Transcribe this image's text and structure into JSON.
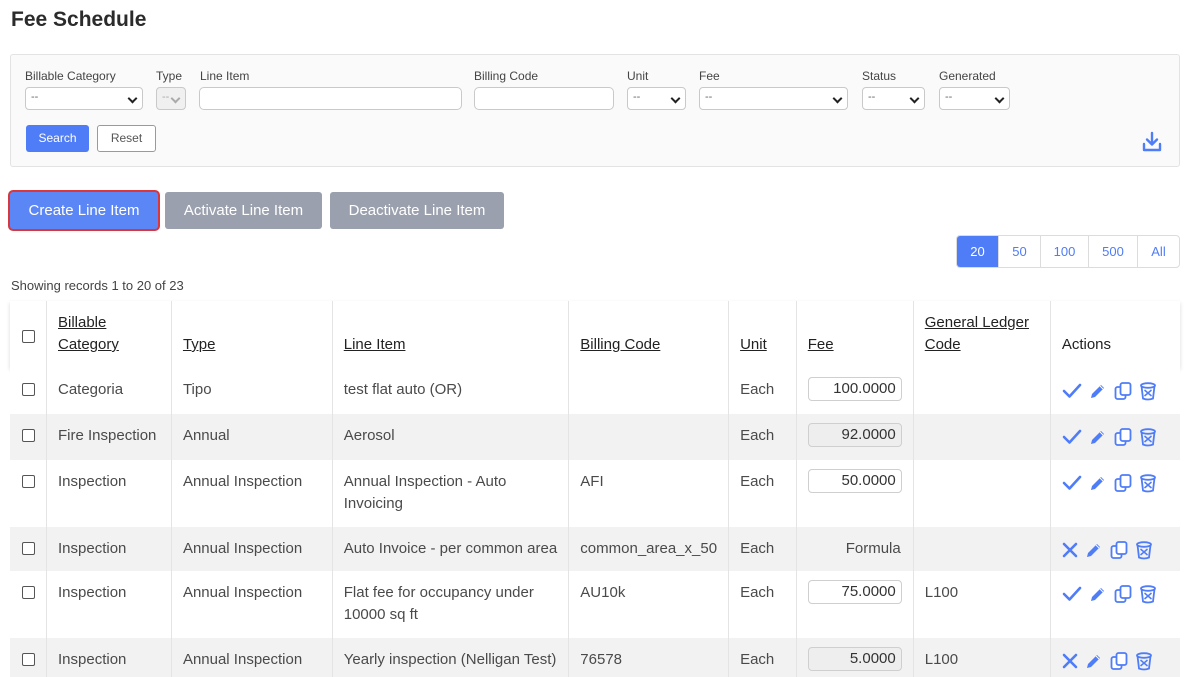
{
  "page": {
    "title": "Fee Schedule"
  },
  "filters": {
    "billable_category": {
      "label": "Billable Category",
      "value": "--"
    },
    "type": {
      "label": "Type",
      "value": "--"
    },
    "line_item": {
      "label": "Line Item",
      "value": ""
    },
    "billing_code": {
      "label": "Billing Code",
      "value": ""
    },
    "unit": {
      "label": "Unit",
      "value": "--"
    },
    "fee": {
      "label": "Fee",
      "value": "--"
    },
    "status": {
      "label": "Status",
      "value": "--"
    },
    "generated": {
      "label": "Generated",
      "value": "--"
    },
    "search_label": "Search",
    "reset_label": "Reset"
  },
  "toolbar": {
    "create_label": "Create Line Item",
    "activate_label": "Activate Line Item",
    "deactivate_label": "Deactivate Line Item"
  },
  "pager": {
    "sizes": [
      "20",
      "50",
      "100",
      "500",
      "All"
    ],
    "selected": "20"
  },
  "records_text": "Showing records 1 to 20 of 23",
  "table": {
    "headers": {
      "billable_category": "Billable Category",
      "type": "Type",
      "line_item": "Line Item",
      "billing_code": "Billing Code",
      "unit": "Unit",
      "fee": "Fee",
      "gl_code": "General Ledger Code",
      "actions": "Actions"
    },
    "rows": [
      {
        "category": "Categoria",
        "type": "Tipo",
        "line_item": "test flat auto (OR)",
        "billing_code": "",
        "unit": "Each",
        "fee": "100.0000",
        "fee_kind": "editable",
        "gl_code": "",
        "status_icon": "check-icon"
      },
      {
        "category": "Fire Inspection",
        "type": "Annual",
        "line_item": "Aerosol",
        "billing_code": "",
        "unit": "Each",
        "fee": "92.0000",
        "fee_kind": "readonly",
        "gl_code": "",
        "status_icon": "check-icon"
      },
      {
        "category": "Inspection",
        "type": "Annual Inspection",
        "line_item": "Annual Inspection - Auto Invoicing",
        "billing_code": "AFI",
        "unit": "Each",
        "fee": "50.0000",
        "fee_kind": "editable",
        "gl_code": "",
        "status_icon": "check-icon"
      },
      {
        "category": "Inspection",
        "type": "Annual Inspection",
        "line_item": "Auto Invoice - per common area",
        "billing_code": "common_area_x_50",
        "unit": "Each",
        "fee": "Formula",
        "fee_kind": "text",
        "gl_code": "",
        "status_icon": "x-icon"
      },
      {
        "category": "Inspection",
        "type": "Annual Inspection",
        "line_item": "Flat fee for occupancy under 10000 sq ft",
        "billing_code": "AU10k",
        "unit": "Each",
        "fee": "75.0000",
        "fee_kind": "editable",
        "gl_code": "L100",
        "status_icon": "check-icon"
      },
      {
        "category": "Inspection",
        "type": "Annual Inspection",
        "line_item": "Yearly inspection (Nelligan Test)",
        "billing_code": "76578",
        "unit": "Each",
        "fee": "5.0000",
        "fee_kind": "readonly",
        "gl_code": "L100",
        "status_icon": "x-icon"
      }
    ]
  },
  "colors": {
    "accent": "#4f7cf7",
    "muted_button": "#9aa0ad",
    "highlight_outline": "#d9363e"
  },
  "icons": {
    "download": "download-icon",
    "edit": "pencil-icon",
    "copy": "copy-icon",
    "delete": "trash-icon"
  }
}
